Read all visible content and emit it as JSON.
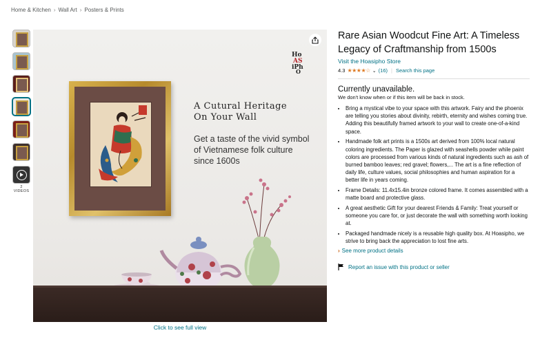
{
  "breadcrumb": [
    "Home & Kitchen",
    "Wall Art",
    "Posters & Prints"
  ],
  "breadcrumb_sep": "›",
  "gallery": {
    "videos_label": "2 VIDEOS",
    "see_full_view": "Click to see full view",
    "image": {
      "headline": "A Cutural Heritage\nOn Your Wall",
      "subline": "Get a taste of the vivid symbol of Vietnamese folk culture since 1600s",
      "logo_text": "HoASiPhO"
    }
  },
  "product": {
    "title": "Rare Asian Woodcut Fine Art: A Timeless Legacy of Craftmanship from 1500s",
    "store_link": "Visit the Hoasipho Store",
    "rating_value": "4.3",
    "rating_stars": "★★★★☆",
    "review_count": "(16)",
    "search_link": "Search this page",
    "availability": "Currently unavailable.",
    "availability_note": "We don't know when or if this item will be back in stock.",
    "bullets": [
      "Bring a mystical vibe to your space with this artwork. Fairy and the phoenix are telling you stories about divinity, rebirth, eternity and wishes coming true. Adding this beautifully framed artwork to your wall to create one-of-a-kind space.",
      "Handmade folk art prints is a 1500s art derived from 100% local natural coloring ingredients. The Paper is glazed with seashells powder while paint colors are processed from various kinds of natural ingredients such as ash of burned bamboo leaves; red gravel; flowers,... The art is a fine reflection of daily life, culture values, social philosophies and human aspiration for a better life in years coming.",
      "Frame Details: 11.4x15.4in bronze colored frame. It comes assembled with a matte board and protective glass.",
      "A great aesthetic Gift for your dearest Friends & Family: Treat yourself or someone you care for, or just decorate the wall with something worth looking at.",
      "Packaged handmade nicely is a reusable high quality box. At Hoasipho, we strive to bring back the appreciation to lost fine arts."
    ],
    "see_more": "See more product details",
    "report_issue": "Report an issue with this product or seller"
  },
  "colors": {
    "link": "#007185",
    "star": "#de7921",
    "frame_gold": "#c99a36"
  }
}
